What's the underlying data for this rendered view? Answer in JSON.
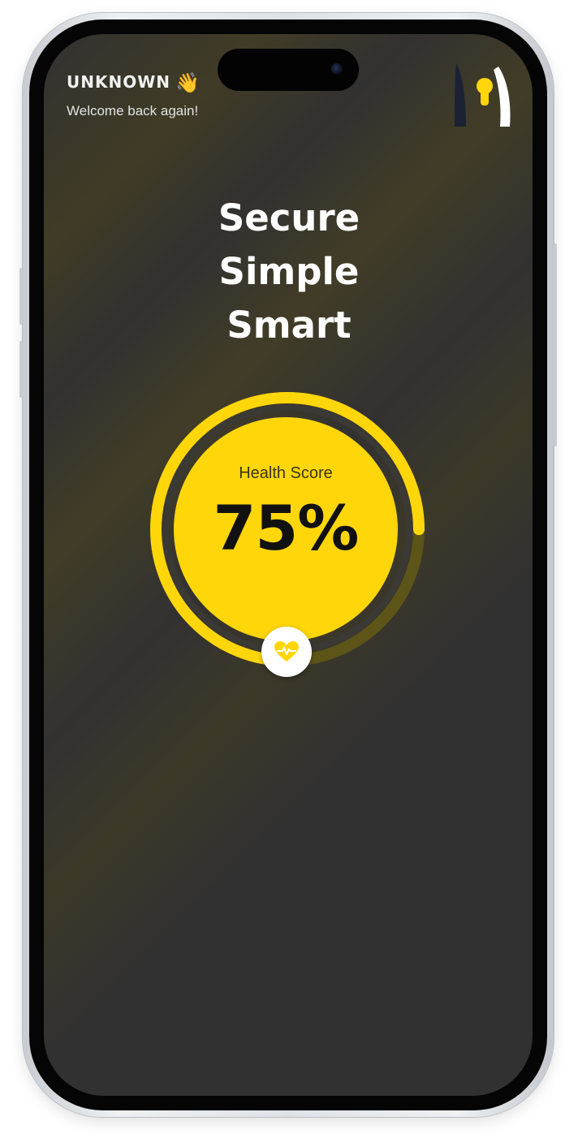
{
  "header": {
    "user_name": "UNKNOWN",
    "greeting_icon": "waving-hand-icon",
    "greeting_glyph": "👋",
    "welcome_text": "Welcome back again!",
    "logo_icon": "keyhole-logo-icon"
  },
  "hero": {
    "tagline_lines": [
      "Secure",
      "Simple",
      "Smart"
    ]
  },
  "health": {
    "label": "Health Score",
    "value_text": "75%",
    "score_fraction": 0.75,
    "button_icon": "heartbeat-icon"
  },
  "colors": {
    "accent": "#ffd60a",
    "screen_background": "#323131",
    "text_primary": "#ffffff",
    "logo_dark": "#1b2233",
    "heart_button_bg": "#ffffff"
  }
}
